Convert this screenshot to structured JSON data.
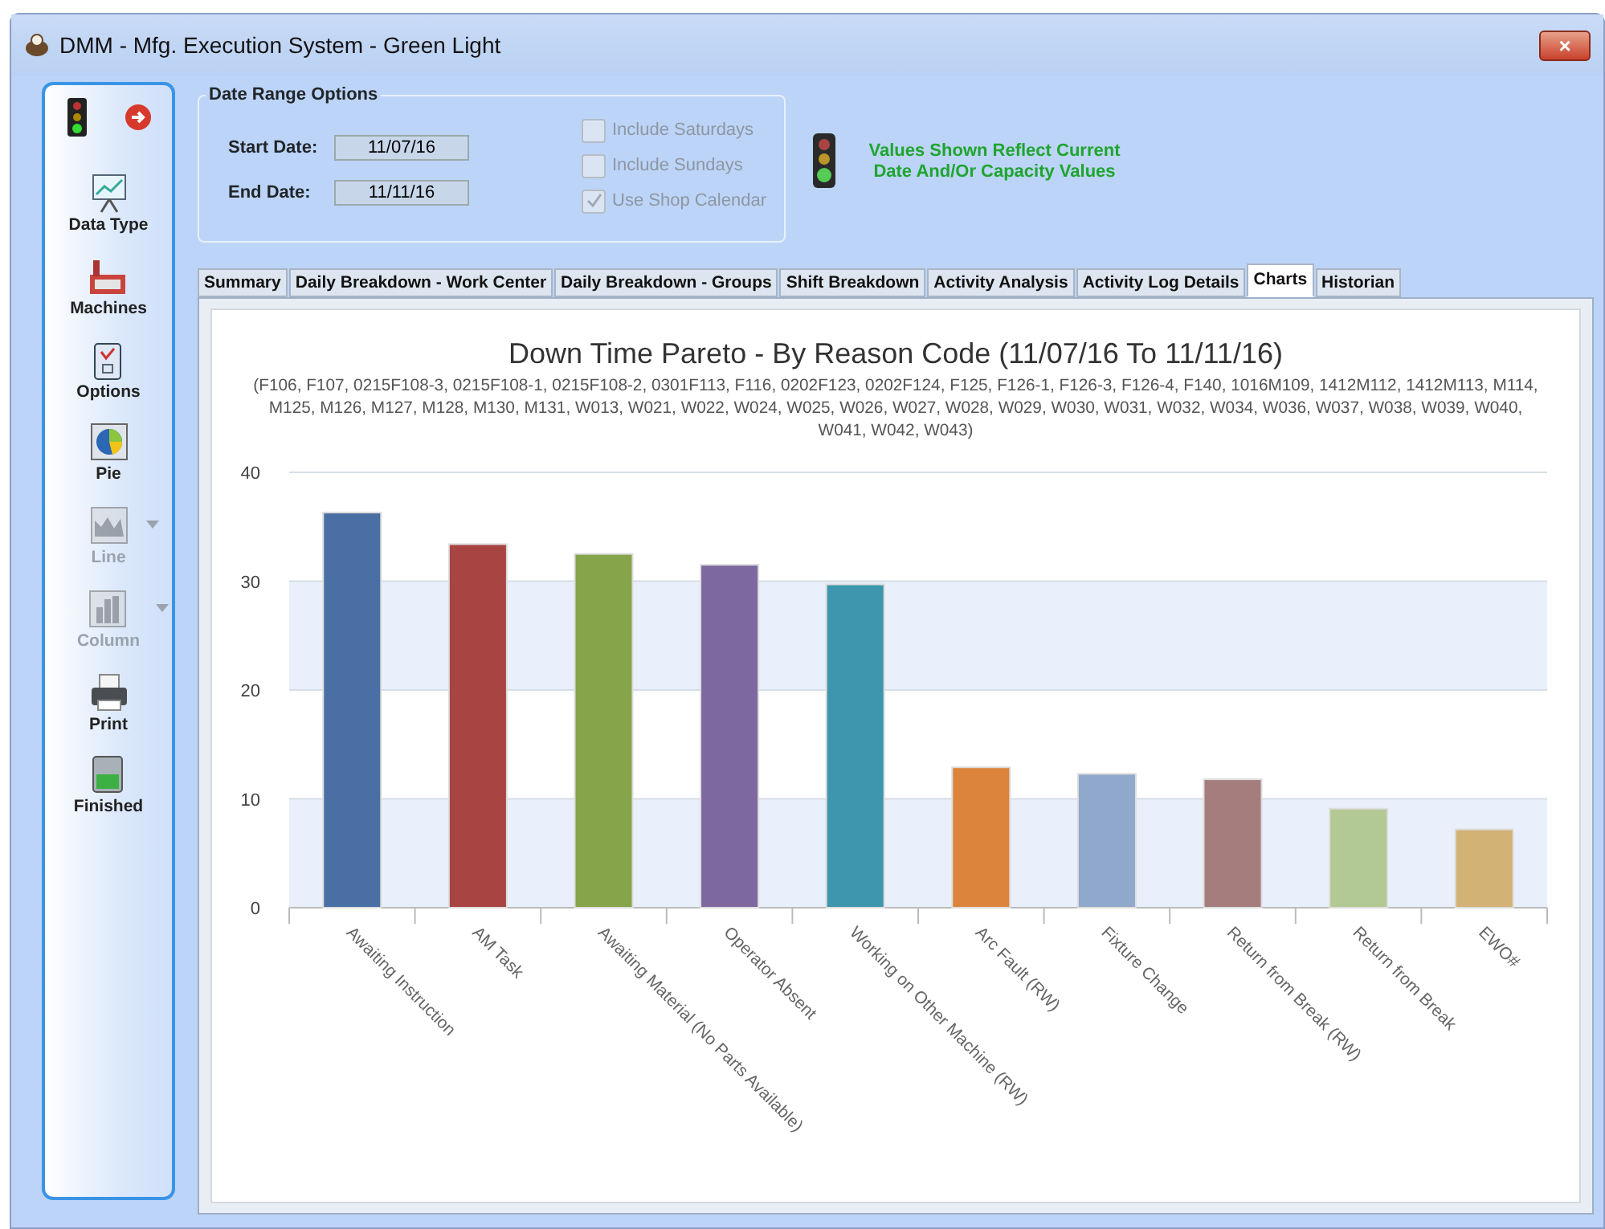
{
  "window": {
    "title": "DMM - Mfg. Execution System - Green Light",
    "close": "×"
  },
  "sidebar": {
    "items": [
      {
        "kind": "lights"
      },
      {
        "kind": "tool",
        "label": "Data Type",
        "disabled": false,
        "dropdown": false
      },
      {
        "kind": "tool",
        "label": "Machines",
        "disabled": false,
        "dropdown": false
      },
      {
        "kind": "tool",
        "label": "Options",
        "disabled": false,
        "dropdown": false
      },
      {
        "kind": "tool",
        "label": "Pie",
        "disabled": false,
        "dropdown": false
      },
      {
        "kind": "tool",
        "label": "Line",
        "disabled": true,
        "dropdown": true
      },
      {
        "kind": "tool",
        "label": "Column",
        "disabled": true,
        "dropdown": true
      },
      {
        "kind": "tool",
        "label": "Print",
        "disabled": false,
        "dropdown": false
      },
      {
        "kind": "tool",
        "label": "Finished",
        "disabled": false,
        "dropdown": false
      }
    ]
  },
  "date_range": {
    "title": "Date Range Options",
    "fields": [
      {
        "label": "Start Date:",
        "value": "11/07/16"
      },
      {
        "label": "End Date:",
        "value": "11/11/16"
      }
    ],
    "checkboxes": [
      {
        "label": "Include Saturdays",
        "checked": false,
        "disabled": true
      },
      {
        "label": "Include Sundays",
        "checked": false,
        "disabled": true
      },
      {
        "label": "Use Shop Calendar",
        "checked": true,
        "disabled": true
      }
    ]
  },
  "notice": "Values Shown Reflect Current Date And/Or Capacity Values",
  "tabs": [
    {
      "label": "Summary",
      "selected": false
    },
    {
      "label": "Daily Breakdown - Work Center",
      "selected": false
    },
    {
      "label": "Daily Breakdown - Groups",
      "selected": false
    },
    {
      "label": "Shift Breakdown",
      "selected": false
    },
    {
      "label": "Activity Analysis",
      "selected": false
    },
    {
      "label": "Activity Log Details",
      "selected": false
    },
    {
      "label": "Charts",
      "selected": true
    },
    {
      "label": "Historian",
      "selected": false
    }
  ],
  "chart": {
    "chart_data": {
      "type": "bar",
      "title": "Down Time Pareto - By Reason Code (11/07/16 To 11/11/16)",
      "subtitle": "(F106, F107, 0215F108-3, 0215F108-1, 0215F108-2, 0301F113, F116, 0202F123, 0202F124, F125, F126-1, F126-3, F126-4, F140, 1016M109, 1412M112, 1412M113, M114, M125, M126, M127, M128, M130, M131, W013, W021, W022, W024, W025, W026, W027, W028, W029, W030, W031, W032, W034, W036, W037, W038, W039, W040, W041, W042, W043)",
      "categories": [
        "Awaiting Instruction",
        "AM Task",
        "Awaiting Material (No Parts Available)",
        "Operator Absent",
        "Working on Other Machine (RW)",
        "Arc Fault (RW)",
        "Fixture Change",
        "Return from Break (RW)",
        "Return from Break",
        "EWO#"
      ],
      "values": [
        36.3,
        33.4,
        32.5,
        31.5,
        29.7,
        12.9,
        12.3,
        11.8,
        9.1,
        7.2
      ],
      "colors": [
        "#4a6fa5",
        "#a84442",
        "#86a44a",
        "#7d68a0",
        "#3d96ae",
        "#dc843b",
        "#90a8cc",
        "#a47d7c",
        "#b3c993",
        "#d3b276"
      ],
      "grid": true,
      "ylim": [
        0,
        40
      ],
      "yticks": [
        0,
        10,
        20,
        30,
        40
      ]
    }
  }
}
